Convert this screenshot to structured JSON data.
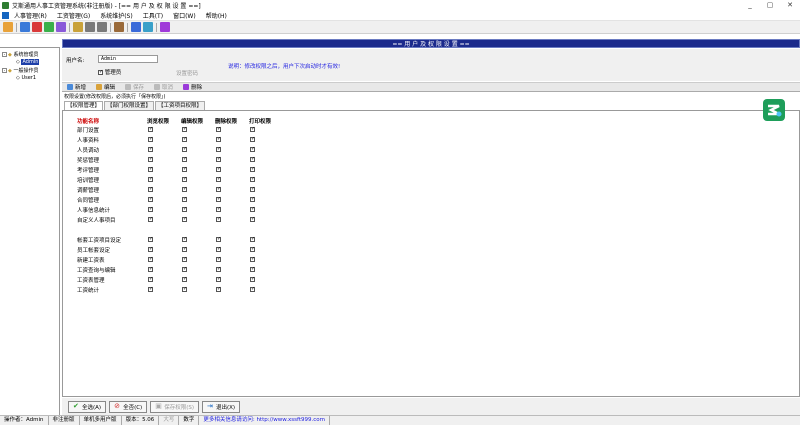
{
  "window": {
    "title": "艾斯通用人事工资管理系统(非注册版) - [== 用 户 及 权 限 设 置 ==]",
    "controls": [
      "_",
      "▢",
      "✕"
    ]
  },
  "menu": [
    "人事管理(R)",
    "工资管理(G)",
    "系统维护(S)",
    "工具(T)",
    "窗口(W)",
    "帮助(H)"
  ],
  "tree": {
    "group1": "系统管理员",
    "user1": "Admin",
    "group2": "一般操作员",
    "user2": "User1"
  },
  "header": {
    "title": "== 用 户 及 权 限 设 置 =="
  },
  "form": {
    "username_label": "用户名:",
    "username_value": "Admin",
    "admin_checkbox_label": "管理员",
    "set_password": "设置密码",
    "notice": "说明：修改权限之后，用户下次启动时才有效!"
  },
  "actions": {
    "new": "新增",
    "edit": "编辑",
    "save": "保存",
    "cancel": "取消",
    "delete": "删除"
  },
  "perm_note": "权限设置(修改权限后，必须执行「保存权限」)",
  "tabs": [
    "【权限管理】",
    "【部门权限设置】",
    "【工资项目权限】"
  ],
  "grid": {
    "headers": [
      "功能名称",
      "浏览权限",
      "编辑权限",
      "删除权限",
      "打印权限"
    ],
    "rows": [
      {
        "name": "部门设置",
        "checks": [
          true,
          true,
          true,
          true
        ]
      },
      {
        "name": "人事资料",
        "checks": [
          true,
          true,
          true,
          true
        ]
      },
      {
        "name": "人员调动",
        "checks": [
          true,
          true,
          true,
          true
        ]
      },
      {
        "name": "奖惩管理",
        "checks": [
          true,
          true,
          true,
          true
        ]
      },
      {
        "name": "考评管理",
        "checks": [
          true,
          true,
          true,
          true
        ]
      },
      {
        "name": "培训管理",
        "checks": [
          true,
          true,
          true,
          true
        ]
      },
      {
        "name": "调薪管理",
        "checks": [
          true,
          true,
          true,
          true
        ]
      },
      {
        "name": "合同管理",
        "checks": [
          true,
          true,
          true,
          true
        ]
      },
      {
        "name": "人事信息统计",
        "checks": [
          true,
          true,
          true,
          true
        ]
      },
      {
        "name": "自定义人事项目",
        "checks": [
          true,
          true,
          true,
          true
        ]
      },
      {
        "name": "",
        "checks": []
      },
      {
        "name": "帐套工资项目设定",
        "checks": [
          true,
          true,
          true,
          true
        ]
      },
      {
        "name": "员工帐套设定",
        "checks": [
          true,
          true,
          true,
          true
        ]
      },
      {
        "name": "新建工资表",
        "checks": [
          true,
          true,
          true,
          true
        ]
      },
      {
        "name": "工资查询与编辑",
        "checks": [
          true,
          true,
          true,
          true
        ]
      },
      {
        "name": "工资表管理",
        "checks": [
          true,
          true,
          true,
          true
        ]
      },
      {
        "name": "工资统计",
        "checks": [
          true,
          true,
          true,
          true
        ]
      }
    ]
  },
  "bottom_buttons": {
    "select_all": "全选(A)",
    "select_none": "全否(C)",
    "save_perm": "保存权限(S)",
    "exit": "退出(X)"
  },
  "status": {
    "operator": "操作者：Admin",
    "reg": "非注册版",
    "mode": "单机多用户版",
    "version": "版本：5.06",
    "caps": "大写",
    "num": "数字",
    "website": "更多相关信息请访问: http://www.xssft999.com"
  },
  "colors": {
    "header_bg": "#1b2a8c",
    "notice_text": "#1a1ae0",
    "grid_header_red": "#c00000"
  }
}
